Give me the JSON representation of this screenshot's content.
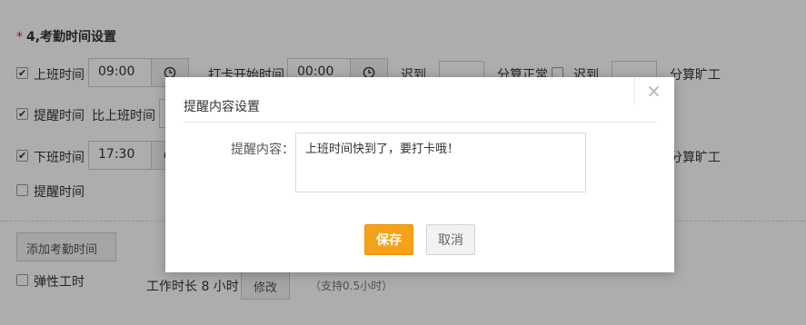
{
  "section": {
    "star": "*",
    "title": "4,考勤时间设置"
  },
  "row1": {
    "label": "上班时间",
    "time_value": "09:00",
    "checkin_start_label": "打卡开始时间",
    "checkin_start_value": "00:00",
    "late_label": "迟到",
    "late_value": "",
    "count_normal_label": "分算正常",
    "late_label_2": "迟到",
    "late_value_2": "",
    "absent_label": "分算旷工"
  },
  "row2": {
    "label": "提醒时间",
    "before_label": "比上班时间"
  },
  "row3": {
    "label": "下班时间",
    "time_value": "17:30",
    "absent_label": "分算旷工"
  },
  "row4": {
    "label": "提醒时间"
  },
  "add_button": "添加考勤时间",
  "flex": {
    "label": "弹性工时",
    "duration_text": "工作时长 8 小时",
    "edit_button": "修改",
    "hint": "（支持0.5小时）"
  },
  "modal": {
    "title": "提醒内容设置",
    "close_glyph": "×",
    "content_label": "提醒内容：",
    "content_value": "上班时间快到了，要打卡哦！",
    "save_label": "保存",
    "cancel_label": "取消"
  },
  "colors": {
    "accent": "#f5a21a",
    "required_star": "#e02020"
  }
}
